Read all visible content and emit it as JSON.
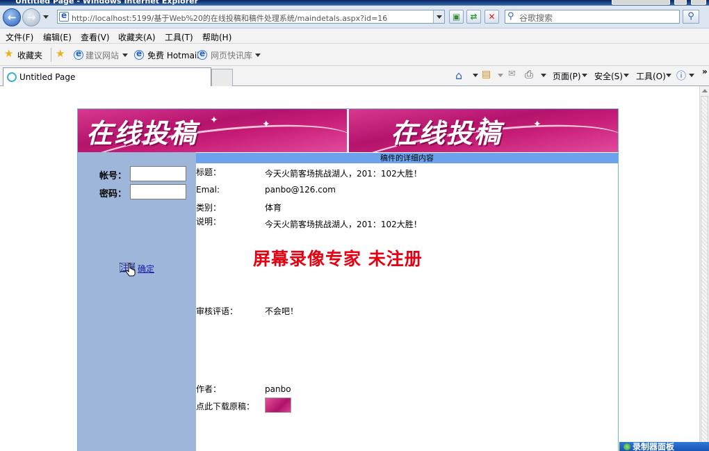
{
  "browser": {
    "window_title": "Untitled Page - Windows Internet Explorer",
    "address": "http://localhost:5199/基于Web%20的在线投稿和稿件处理系统/maindetals.aspx?id=16",
    "search_placeholder": "谷歌搜索",
    "menu": [
      "文件(F)",
      "编辑(E)",
      "查看(V)",
      "收藏夹(A)",
      "工具(T)",
      "帮助(H)"
    ],
    "favorites_label": "收藏夹",
    "fav_links": [
      "建议网站",
      "免费 Hotmail",
      "网页快讯库"
    ],
    "tab_title": "Untitled Page",
    "commands": {
      "page": "页面(P)",
      "safety": "安全(S)",
      "tools": "工具(O)"
    }
  },
  "site": {
    "banner_title": "在线投稿",
    "login": {
      "account_label": "帐号：",
      "password_label": "密码：",
      "account_value": "",
      "password_value": "",
      "register_link": "注册",
      "ok_link": "确定"
    },
    "detail": {
      "section_title": "稿件的详细内容",
      "fields": [
        {
          "label": "标题：",
          "value": "今天火箭客场挑战湖人，201：102大胜！"
        },
        {
          "label": "Emal:",
          "value": "panbo@126.com"
        },
        {
          "label": "类别：",
          "value": "体育"
        },
        {
          "label": "说明：",
          "value": "今天火箭客场挑战湖人，201：102大胜！"
        },
        {
          "label": "审核评语：",
          "value": "不会吧！"
        },
        {
          "label": "作者：",
          "value": "panbo"
        },
        {
          "label": "点此下载原稿：",
          "value": ""
        }
      ]
    },
    "watermark": "屏幕录像专家  未注册"
  },
  "overlay": {
    "recorder_panel": "录制器面板"
  },
  "colors": {
    "sidebar": "#9db6d9",
    "section_header": "#6aa3ec",
    "banner": "#c71d76",
    "watermark": "#e60012",
    "link": "#1a1aa8"
  }
}
